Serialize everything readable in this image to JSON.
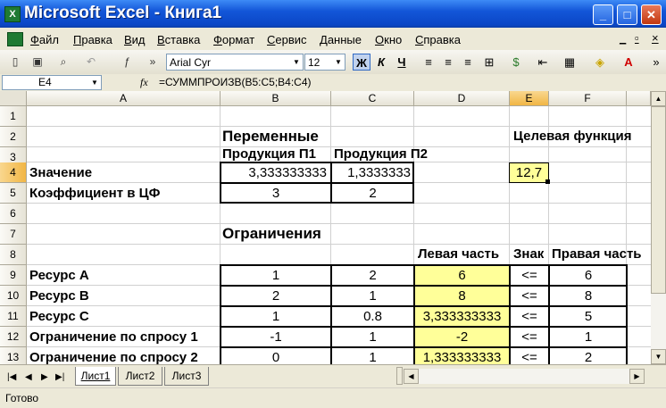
{
  "window": {
    "title": "Microsoft Excel - Книга1",
    "app_icon": "excel-icon",
    "controls": [
      "_",
      "□",
      "✕"
    ]
  },
  "menu": {
    "items": [
      "Файл",
      "Правка",
      "Вид",
      "Вставка",
      "Формат",
      "Сервис",
      "Данные",
      "Окно",
      "Справка"
    ],
    "doc_controls": [
      "_",
      "▫",
      "×"
    ]
  },
  "toolbar": {
    "font_name": "Arial Cyr",
    "font_size": "12",
    "bold": "Ж",
    "italic": "К",
    "underline": "Ч"
  },
  "formula_bar": {
    "name_box": "E4",
    "fx": "fx",
    "formula": "=СУММПРОИЗВ(B5:C5;B4:C4)"
  },
  "sheet": {
    "columns": [
      "A",
      "B",
      "C",
      "D",
      "E",
      "F"
    ],
    "selected_column": "E",
    "rows": [
      "1",
      "2",
      "3",
      "4",
      "5",
      "6",
      "7",
      "8",
      "9",
      "10",
      "11",
      "12",
      "13"
    ],
    "selected_row": "4",
    "cells": {
      "B2": "Переменные",
      "E2": "Целевая функция",
      "B3": "Продукция П1",
      "C3": "Продукция П2",
      "A4": "Значение",
      "B4": "3,333333333",
      "C4": "1,3333333",
      "E4": "12,7",
      "A5": "Коэффициент в ЦФ",
      "B5": "3",
      "C5": "2",
      "B7": "Ограничения",
      "D8": "Левая часть",
      "E8": "Знак",
      "F8": "Правая часть",
      "A9": "Ресурс А",
      "B9": "1",
      "C9": "2",
      "D9": "6",
      "E9": "<=",
      "F9": "6",
      "A10": "Ресурс В",
      "B10": "2",
      "C10": "1",
      "D10": "8",
      "E10": "<=",
      "F10": "8",
      "A11": "Ресурс С",
      "B11": "1",
      "C11": "0.8",
      "D11": "3,333333333",
      "E11": "<=",
      "F11": "5",
      "A12": "Ограничение по спросу 1",
      "B12": "-1",
      "C12": "1",
      "D12": "-2",
      "E12": "<=",
      "F12": "1",
      "A13": "Ограничение по спросу 2",
      "B13": "0",
      "C13": "1",
      "D13": "1,333333333",
      "E13": "<=",
      "F13": "2"
    }
  },
  "tabs": [
    "Лист1",
    "Лист2",
    "Лист3"
  ],
  "active_tab": "Лист1",
  "status": "Готово"
}
